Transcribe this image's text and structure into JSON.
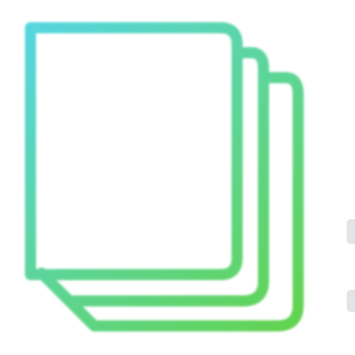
{
  "icon": {
    "name": "document-stack-icon",
    "page_count": 3,
    "gradient": {
      "start": "#57d6df",
      "end": "#63d34c"
    },
    "background": "#ffffff"
  },
  "edge_marks": {
    "color": "#e3e4e6"
  }
}
